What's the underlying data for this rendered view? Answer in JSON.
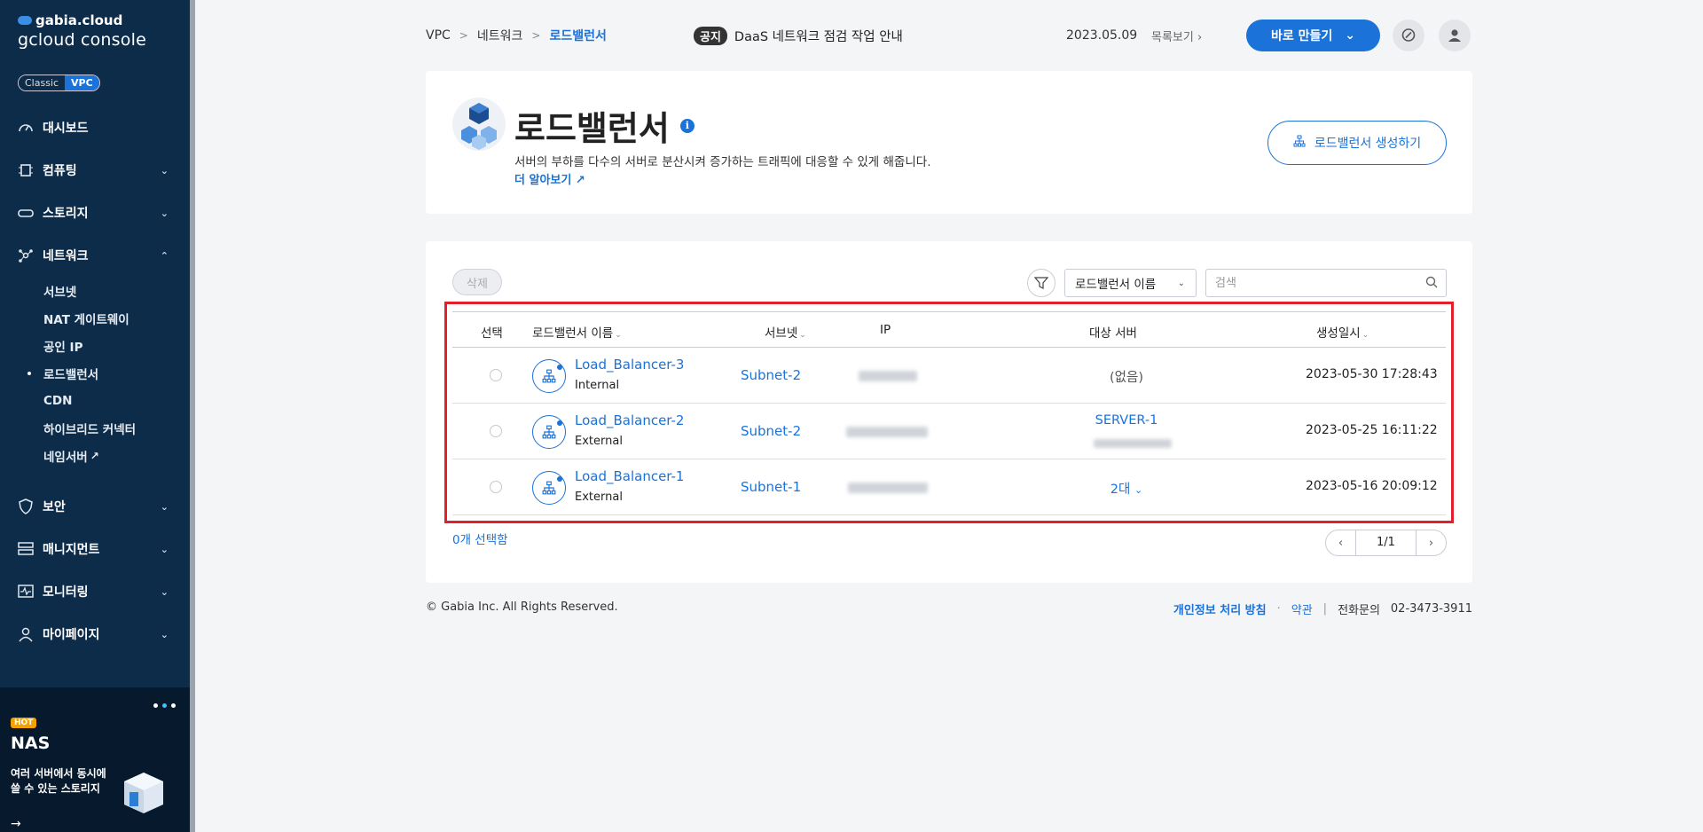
{
  "brand": {
    "top": "gabia.cloud",
    "console": "gcloud console"
  },
  "mode_toggle": {
    "classic": "Classic",
    "vpc": "VPC"
  },
  "sidebar": {
    "items": [
      {
        "label": "대시보드",
        "icon": "gauge-icon"
      },
      {
        "label": "컴퓨팅",
        "icon": "chip-icon"
      },
      {
        "label": "스토리지",
        "icon": "storage-icon"
      },
      {
        "label": "네트워크",
        "icon": "network-icon"
      }
    ],
    "network_sub": [
      {
        "label": "서브넷"
      },
      {
        "label": "NAT 게이트웨이"
      },
      {
        "label": "공인 IP"
      },
      {
        "label": "로드밸런서"
      },
      {
        "label": "CDN"
      },
      {
        "label": "하이브리드 커넥터"
      },
      {
        "label": "네임서버"
      }
    ],
    "items_bottom": [
      {
        "label": "보안",
        "icon": "shield-icon"
      },
      {
        "label": "매니지먼트",
        "icon": "server-rack-icon"
      },
      {
        "label": "모니터링",
        "icon": "monitor-icon"
      },
      {
        "label": "마이페이지",
        "icon": "user-icon"
      }
    ]
  },
  "banner": {
    "hot": "HOT",
    "title": "NAS",
    "desc_line1": "여러 서버에서 동시에",
    "desc_line2": "쓸 수 있는 스토리지"
  },
  "breadcrumb": {
    "root": "VPC",
    "section": "네트워크",
    "current": "로드밸런서"
  },
  "notice": {
    "tag": "공지",
    "text": "DaaS 네트워크 점검 작업 안내",
    "date": "2023.05.09",
    "more": "목록보기"
  },
  "header": {
    "make_button": "바로 만들기"
  },
  "page": {
    "title": "로드밸런서",
    "info": "i",
    "description": "서버의 부하를 다수의 서버로 분산시켜 증가하는 트래픽에 대응할 수 있게 해줍니다.",
    "learn_more": "더 알아보기",
    "create_button": "로드밸런서 생성하기"
  },
  "toolbar": {
    "delete": "삭제",
    "filter_selected": "로드밸런서 이름",
    "search_placeholder": "검색"
  },
  "table": {
    "columns": [
      "선택",
      "로드밸런서 이름",
      "서브넷",
      "IP",
      "대상 서버",
      "생성일시"
    ],
    "rows": [
      {
        "name": "Load_Balancer-3",
        "type": "Internal",
        "subnet": "Subnet-2",
        "target": "(없음)",
        "target_sub": "",
        "created": "2023-05-30 17:28:43"
      },
      {
        "name": "Load_Balancer-2",
        "type": "External",
        "subnet": "Subnet-2",
        "target": "SERVER-1",
        "target_sub": "",
        "created": "2023-05-25 16:11:22"
      },
      {
        "name": "Load_Balancer-1",
        "type": "External",
        "subnet": "Subnet-1",
        "target": "2대",
        "target_sub": "",
        "created": "2023-05-16 20:09:12"
      }
    ],
    "selected_count": "0개 선택함",
    "pagination": "1/1"
  },
  "footer": {
    "copyright": "© Gabia Inc. All Rights Reserved.",
    "privacy": "개인정보 처리 방침",
    "terms": "약관",
    "contact_label": "전화문의",
    "contact_number": "02-3473-3911"
  },
  "colors": {
    "accent": "#1b72d8",
    "sidebar": "#0d2c49",
    "highlight": "#e0202a"
  }
}
